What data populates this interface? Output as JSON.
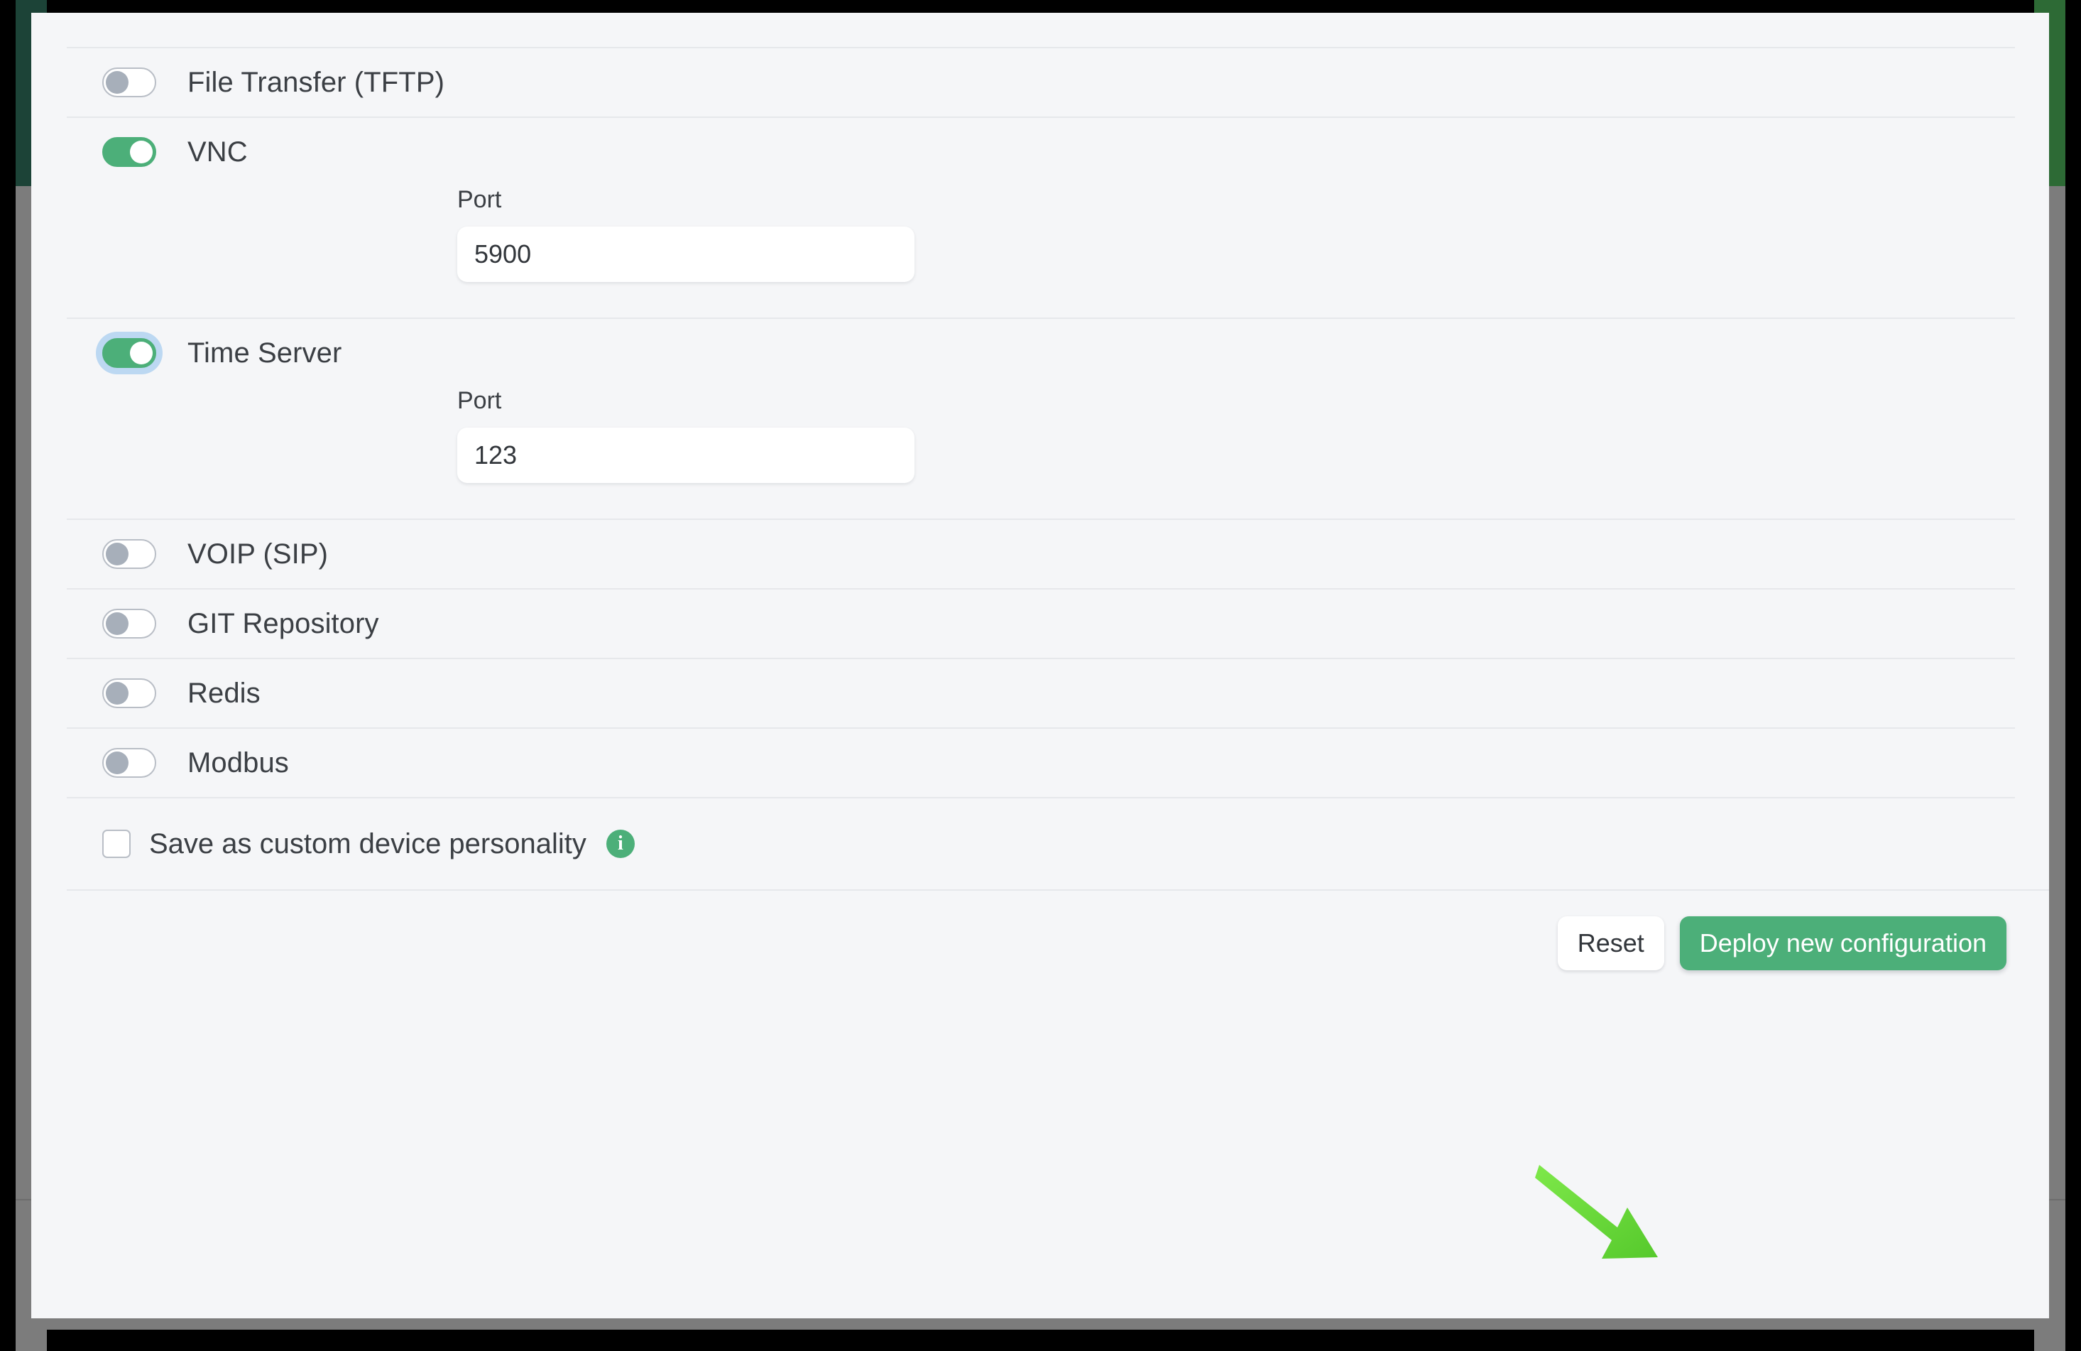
{
  "services": [
    {
      "id": "file-transfer-tftp",
      "label": "File Transfer (TFTP)",
      "enabled": false,
      "focused": false,
      "port_label": null,
      "port_value": null
    },
    {
      "id": "vnc",
      "label": "VNC",
      "enabled": true,
      "focused": false,
      "port_label": "Port",
      "port_value": "5900"
    },
    {
      "id": "time-server",
      "label": "Time Server",
      "enabled": true,
      "focused": true,
      "port_label": "Port",
      "port_value": "123"
    },
    {
      "id": "voip-sip",
      "label": "VOIP (SIP)",
      "enabled": false,
      "focused": false,
      "port_label": null,
      "port_value": null
    },
    {
      "id": "git-repository",
      "label": "GIT Repository",
      "enabled": false,
      "focused": false,
      "port_label": null,
      "port_value": null
    },
    {
      "id": "redis",
      "label": "Redis",
      "enabled": false,
      "focused": false,
      "port_label": null,
      "port_value": null
    },
    {
      "id": "modbus",
      "label": "Modbus",
      "enabled": false,
      "focused": false,
      "port_label": null,
      "port_value": null
    }
  ],
  "personality": {
    "label": "Save as custom device personality",
    "checked": false,
    "info_icon": "info-icon"
  },
  "footer": {
    "reset_label": "Reset",
    "deploy_label": "Deploy new configuration"
  },
  "annotation": {
    "arrow_icon": "annotation-arrow",
    "arrow_color": "#6ee13c",
    "points_to": "Deploy new configuration"
  },
  "colors": {
    "accent_green": "#4caf79",
    "toggle_off_knob": "#a7afba",
    "focus_ring": "#bcd8f2",
    "card_background": "#f5f6f8",
    "divider": "#e6e8eb",
    "edge_left_green": "#1c4337",
    "edge_right_green": "#2d6a35",
    "edge_gray": "#7c7c7c"
  }
}
